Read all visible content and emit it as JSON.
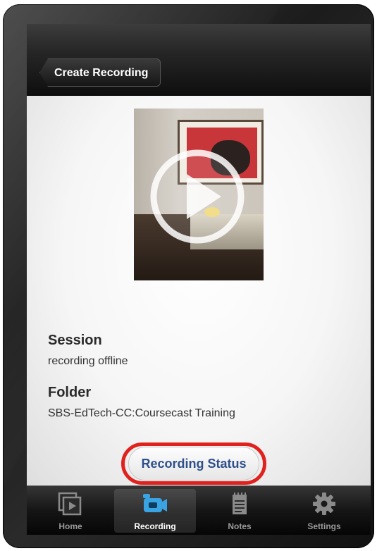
{
  "nav": {
    "back_label": "Create Recording"
  },
  "recording": {
    "thumbnail_icon": "play-icon",
    "session_heading": "Session",
    "session_value": "recording offline",
    "folder_heading": "Folder",
    "folder_value": "SBS-EdTech-CC:Coursecast Training",
    "status_button_label": "Recording Status",
    "highlight_color": "#e0211d"
  },
  "tab_bar": {
    "tabs": [
      {
        "label": "Home",
        "icon": "home-icon",
        "selected": false
      },
      {
        "label": "Recording",
        "icon": "video-camera-icon",
        "selected": true
      },
      {
        "label": "Notes",
        "icon": "notepad-icon",
        "selected": false
      },
      {
        "label": "Settings",
        "icon": "gear-icon",
        "selected": false
      }
    ]
  },
  "colors": {
    "accent_text": "#2d4f8c",
    "selected_tab_icon": "#3aa3e3"
  }
}
